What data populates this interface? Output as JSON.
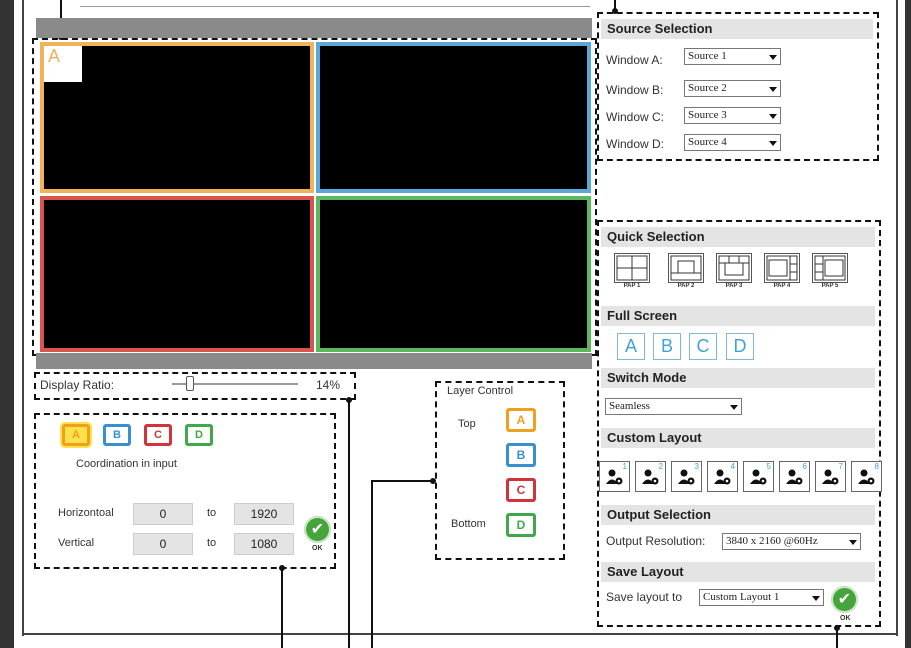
{
  "windows": [
    {
      "id": "A",
      "color": "#f0b25a",
      "tag": "A"
    },
    {
      "id": "B",
      "color": "#59a8d9"
    },
    {
      "id": "C",
      "color": "#d9534f"
    },
    {
      "id": "D",
      "color": "#5cb85c"
    }
  ],
  "source_selection": {
    "title": "Source Selection",
    "rows": [
      {
        "label": "Window A:",
        "value": "Source 1"
      },
      {
        "label": "Window B:",
        "value": "Source 2"
      },
      {
        "label": "Window C:",
        "value": "Source 3"
      },
      {
        "label": "Window D:",
        "value": "Source 4"
      }
    ]
  },
  "quick_selection": {
    "title": "Quick Selection",
    "items": [
      "PAP 1",
      "PAP 2",
      "PAP 3",
      "PAP 4",
      "PAP 5"
    ]
  },
  "full_screen": {
    "title": "Full Screen",
    "buttons": [
      "A",
      "B",
      "C",
      "D"
    ]
  },
  "switch_mode": {
    "title": "Switch Mode",
    "value": "Seamless"
  },
  "custom_layout": {
    "title": "Custom Layout",
    "icon": "user-gear-icon",
    "numbers": [
      "1",
      "2",
      "3",
      "4",
      "5",
      "6",
      "7",
      "8"
    ]
  },
  "output_selection": {
    "title": "Output Selection",
    "label": "Output Resolution:",
    "value": "3840 x 2160 @60Hz"
  },
  "save_layout": {
    "title": "Save Layout",
    "label": "Save layout to",
    "value": "Custom Layout 1",
    "ok": "OK"
  },
  "display_ratio": {
    "label": "Display Ratio:",
    "value": "14%",
    "slider_level": 0.14
  },
  "coordination": {
    "buttons": [
      {
        "label": "A",
        "color": "#f0a020",
        "selected": true
      },
      {
        "label": "B",
        "color": "#3a8fd0"
      },
      {
        "label": "C",
        "color": "#d0343a"
      },
      {
        "label": "D",
        "color": "#3fa84a"
      }
    ],
    "caption": "Coordination in input",
    "horizontal": {
      "label": "Horizontoal",
      "from": "0",
      "to_label": "to",
      "to": "1920"
    },
    "vertical": {
      "label": "Vertical",
      "from": "0",
      "to_label": "to",
      "to": "1080"
    },
    "ok": "OK"
  },
  "layer_control": {
    "title": "Layer Control",
    "top_label": "Top",
    "bottom_label": "Bottom",
    "layers": [
      {
        "label": "A",
        "color": "#f0a020"
      },
      {
        "label": "B",
        "color": "#3a8fd0"
      },
      {
        "label": "C",
        "color": "#d0343a"
      },
      {
        "label": "D",
        "color": "#3fa84a"
      }
    ]
  }
}
